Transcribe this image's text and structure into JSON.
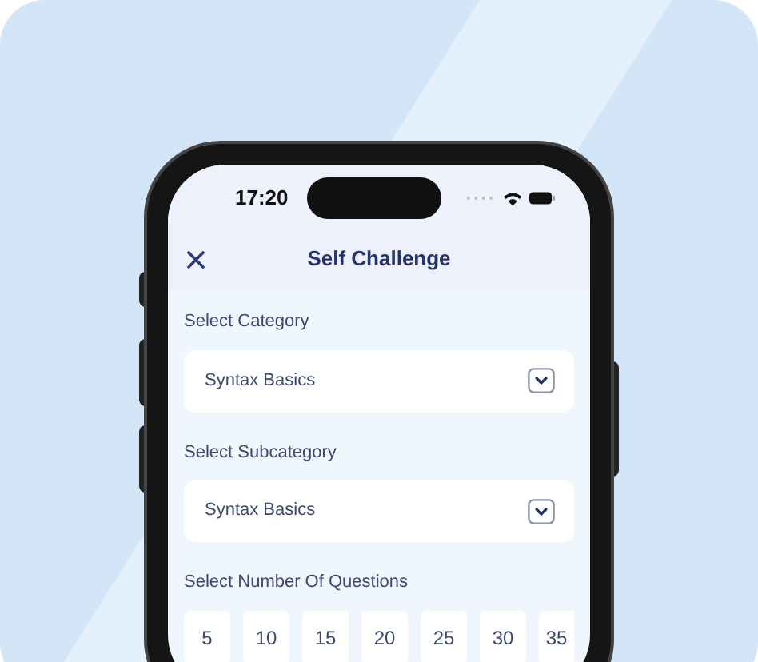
{
  "status_bar": {
    "time": "17:20"
  },
  "header": {
    "title": "Self Challenge"
  },
  "dropdowns": [
    {
      "label": "Select Category",
      "value": "Syntax Basics"
    },
    {
      "label": "Select Subcategory",
      "value": "Syntax Basics"
    }
  ],
  "question_count": {
    "label": "Select Number Of Questions",
    "options": [
      "5",
      "10",
      "15",
      "20",
      "25",
      "30",
      "35"
    ]
  }
}
